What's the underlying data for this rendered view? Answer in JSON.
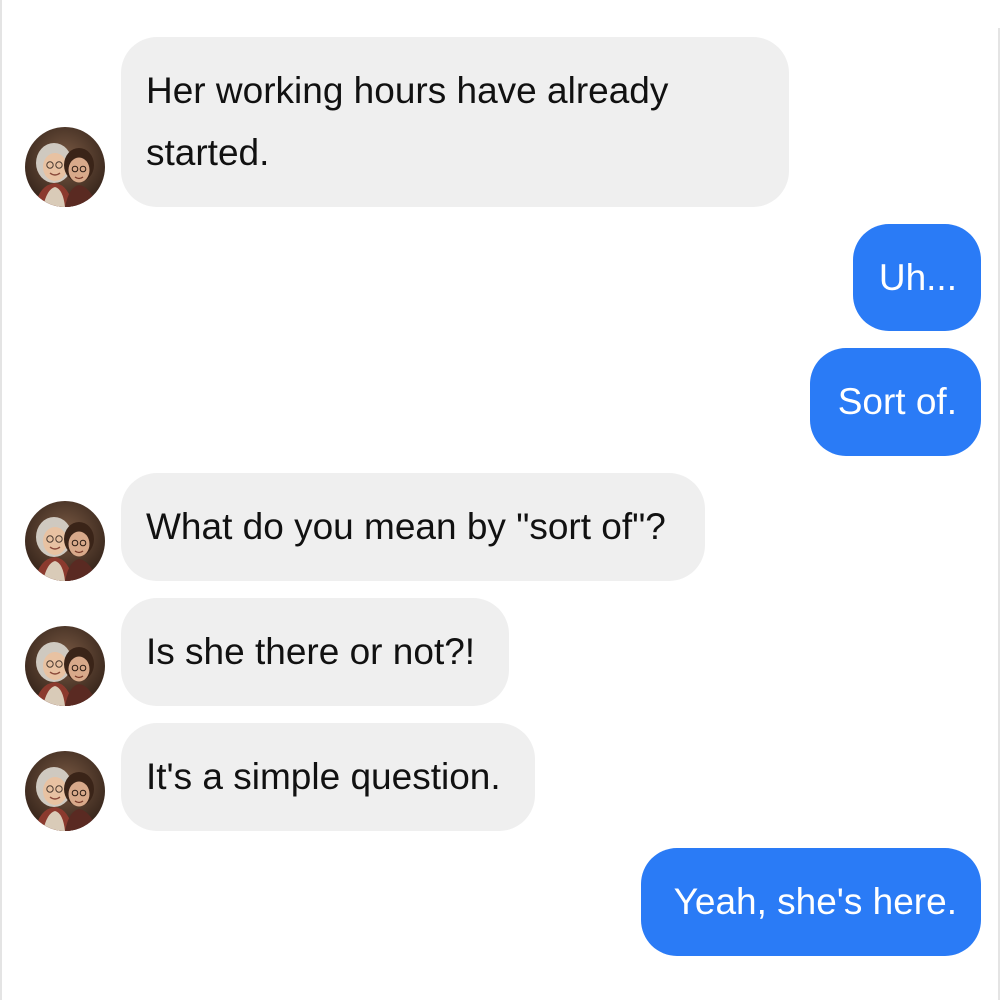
{
  "chat": {
    "contact": {
      "avatar_icon": "contact-photo-two-women"
    },
    "colors": {
      "incoming_bubble": "#efefef",
      "outgoing_bubble": "#2a7bf6",
      "incoming_text": "#111111",
      "outgoing_text": "#ffffff"
    },
    "messages": [
      {
        "direction": "incoming",
        "lines": [
          "Her working hours have already",
          "started."
        ]
      },
      {
        "direction": "outgoing",
        "text": "Uh..."
      },
      {
        "direction": "outgoing",
        "text": "Sort of."
      },
      {
        "direction": "incoming",
        "text": "What do you mean by \"sort of\"?"
      },
      {
        "direction": "incoming",
        "text": "Is she there or not?!"
      },
      {
        "direction": "incoming",
        "text": "It's a simple question."
      },
      {
        "direction": "outgoing",
        "text": "Yeah, she's here."
      }
    ]
  }
}
